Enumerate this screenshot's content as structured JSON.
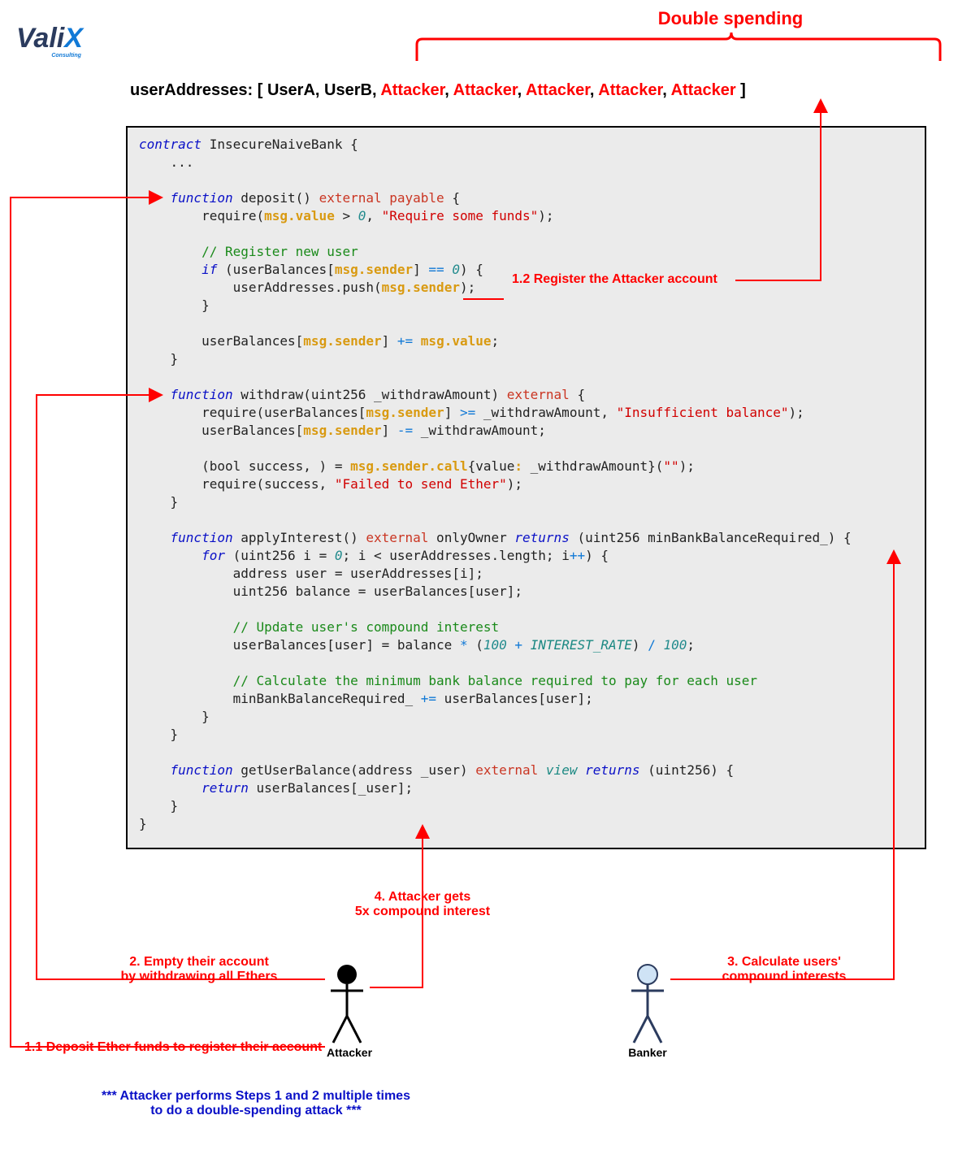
{
  "logo": {
    "prefix": "Vali",
    "x": "X",
    "sub": "Consulting"
  },
  "title": "Double spending",
  "array": {
    "label": "userAddresses: [ ",
    "userA": "UserA",
    "sep": ", ",
    "userB": "UserB",
    "attacker": "Attacker",
    "close": " ]"
  },
  "code": {
    "l1a": "contract",
    "l1b": " InsecureNaiveBank ",
    "l1c": "{",
    "l2": "    ...",
    "l3": "",
    "l4a": "    ",
    "l4b": "function",
    "l4c": " deposit() ",
    "l4d": "external payable",
    "l4e": " {",
    "l5a": "        require(",
    "l5b": "msg.value",
    "l5c": " > ",
    "l5d": "0",
    "l5e": ", ",
    "l5f": "\"Require some funds\"",
    "l5g": ");",
    "l6": "",
    "l7a": "        ",
    "l7b": "// Register new user",
    "l8a": "        ",
    "l8b": "if",
    "l8c": " (userBalances[",
    "l8d": "msg.sender",
    "l8e": "] ",
    "l8f": "==",
    "l8g": " ",
    "l8h": "0",
    "l8i": ") ",
    "l8j": "{",
    "l9a": "            userAddresses.push(",
    "l9b": "msg.sender",
    "l9c": ");",
    "l10": "        }",
    "l11": "",
    "l12a": "        userBalances[",
    "l12b": "msg.sender",
    "l12c": "] ",
    "l12d": "+=",
    "l12e": " ",
    "l12f": "msg.value",
    "l12g": ";",
    "l13": "    }",
    "l14": "",
    "l15a": "    ",
    "l15b": "function",
    "l15c": " withdraw(uint256 _withdrawAmount) ",
    "l15d": "external",
    "l15e": " {",
    "l16a": "        require(userBalances[",
    "l16b": "msg.sender",
    "l16c": "] ",
    "l16d": ">=",
    "l16e": " _withdrawAmount, ",
    "l16f": "\"Insufficient balance\"",
    "l16g": ");",
    "l17a": "        userBalances[",
    "l17b": "msg.sender",
    "l17c": "] ",
    "l17d": "-=",
    "l17e": " _withdrawAmount;",
    "l18": "",
    "l19a": "        (bool success, ) = ",
    "l19b": "msg.sender.call",
    "l19c": "{value",
    "l19d": ":",
    "l19e": " _withdrawAmount}(",
    "l19f": "\"\"",
    "l19g": ");",
    "l20a": "        require(success, ",
    "l20b": "\"Failed to send Ether\"",
    "l20c": ");",
    "l21": "    }",
    "l22": "",
    "l23a": "    ",
    "l23b": "function",
    "l23c": " applyInterest() ",
    "l23d": "external",
    "l23e": " onlyOwner ",
    "l23f": "returns",
    "l23g": " (uint256 minBankBalanceRequired_) ",
    "l23h": "{",
    "l24a": "        ",
    "l24b": "for",
    "l24c": " (uint256 i = ",
    "l24d": "0",
    "l24e": "; i < userAddresses.length; i",
    "l24f": "++",
    "l24g": ") ",
    "l24h": "{",
    "l25": "            address user = userAddresses[i];",
    "l26": "            uint256 balance = userBalances[user];",
    "l27": "",
    "l28a": "            ",
    "l28b": "// Update user's compound interest",
    "l29a": "            userBalances[user] = balance ",
    "l29b": "*",
    "l29c": " (",
    "l29d": "100",
    "l29e": " ",
    "l29f": "+",
    "l29g": " ",
    "l29h": "INTEREST_RATE",
    "l29i": ") ",
    "l29j": "/",
    "l29k": " ",
    "l29l": "100",
    "l29m": ";",
    "l30": "",
    "l31a": "            ",
    "l31b": "// Calculate the minimum bank balance required to pay for each user",
    "l32a": "            minBankBalanceRequired_ ",
    "l32b": "+=",
    "l32c": " userBalances[user];",
    "l33": "        }",
    "l34": "    }",
    "l35": "",
    "l36a": "    ",
    "l36b": "function",
    "l36c": " getUserBalance(address _user) ",
    "l36d": "external",
    "l36e": " ",
    "l36f": "view",
    "l36g": " ",
    "l36h": "returns",
    "l36i": " (uint256) ",
    "l36j": "{",
    "l37a": "        ",
    "l37b": "return",
    "l37c": " userBalances[_user];",
    "l38": "    }",
    "l39": "}"
  },
  "annot": {
    "a12": "1.2 Register the Attacker account",
    "a4a": "4.  Attacker gets",
    "a4b": "5x compound interest",
    "a2a": "2. Empty their account",
    "a2b": "by withdrawing all Ethers",
    "a3a": "3. Calculate users'",
    "a3b": "compound interests",
    "a11": "1.1 Deposit Ether funds to register their account",
    "note1": "*** Attacker performs Steps 1 and 2 multiple times",
    "note2": "to do a double-spending attack ***"
  },
  "actors": {
    "attacker": "Attacker",
    "banker": "Banker"
  }
}
